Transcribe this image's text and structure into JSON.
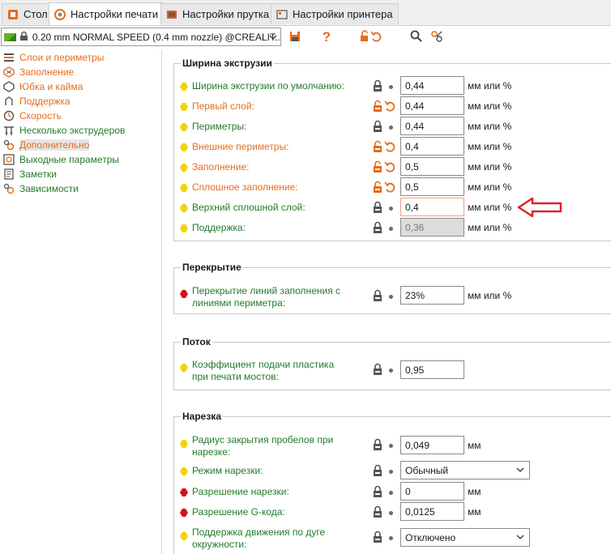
{
  "tabs": [
    {
      "label": "Стол",
      "icon": "plate-icon"
    },
    {
      "label": "Настройки печати",
      "icon": "print-settings-icon"
    },
    {
      "label": "Настройки прутка",
      "icon": "filament-icon"
    },
    {
      "label": "Настройки принтера",
      "icon": "printer-icon"
    }
  ],
  "preset": {
    "value": "0.20 mm NORMAL SPEED (0.4 mm nozzle) @CREALIT..."
  },
  "toolbar": {
    "help_label": "?"
  },
  "sidebar": {
    "items": [
      {
        "label": "Слои и периметры",
        "color": "orange"
      },
      {
        "label": "Заполнение",
        "color": "orange"
      },
      {
        "label": "Юбка и кайма",
        "color": "orange"
      },
      {
        "label": "Поддержка",
        "color": "orange"
      },
      {
        "label": "Скорость",
        "color": "orange"
      },
      {
        "label": "Несколько экструдеров",
        "color": "green"
      },
      {
        "label": "Дополнительно",
        "color": "orange"
      },
      {
        "label": "Выходные параметры",
        "color": "green"
      },
      {
        "label": "Заметки",
        "color": "green"
      },
      {
        "label": "Зависимости",
        "color": "green"
      }
    ]
  },
  "groups": {
    "extrusion_width": {
      "title": "Ширина экструзии",
      "rows": [
        {
          "label": "Ширина экструзии по умолчанию:",
          "value": "0,44",
          "unit": "мм или %"
        },
        {
          "label": "Первый слой:",
          "value": "0,44",
          "unit": "мм или %"
        },
        {
          "label": "Периметры:",
          "value": "0,44",
          "unit": "мм или %"
        },
        {
          "label": "Внешние периметры:",
          "value": "0,4",
          "unit": "мм или %"
        },
        {
          "label": "Заполнение:",
          "value": "0,5",
          "unit": "мм или %"
        },
        {
          "label": "Сплошное заполнение:",
          "value": "0,5",
          "unit": "мм или %"
        },
        {
          "label": "Верхний сплошной слой:",
          "value": "0,4",
          "unit": "мм или %"
        },
        {
          "label": "Поддержка:",
          "value": "0,36",
          "unit": "мм или %"
        }
      ]
    },
    "overlap": {
      "title": "Перекрытие",
      "rows": [
        {
          "label_line1": "Перекрытие линий заполнения с",
          "label_line2": "линиями периметра:",
          "value": "23%",
          "unit": "мм или %"
        }
      ]
    },
    "flow": {
      "title": "Поток",
      "rows": [
        {
          "label_line1": "Коэффициент подачи пластика",
          "label_line2": "при печати мостов:",
          "value": "0,95"
        }
      ]
    },
    "slicing": {
      "title": "Нарезка",
      "rows": [
        {
          "label_line1": "Радиус закрытия пробелов при",
          "label_line2": "нарезке:",
          "value": "0,049",
          "unit": "мм"
        },
        {
          "label": "Режим нарезки:",
          "value": "Обычный"
        },
        {
          "label": "Разрешение нарезки:",
          "value": "0",
          "unit": "мм"
        },
        {
          "label": "Разрешение G-кода:",
          "value": "0,0125",
          "unit": "мм"
        },
        {
          "label_line1": "Поддержка движения по дуге",
          "label_line2": "окружности:",
          "value": "Отключено"
        }
      ]
    }
  },
  "colors": {
    "orange": "#e56c1f",
    "green": "#247a2b",
    "bullet_yellow": "#f2d20a",
    "bullet_red": "#d4101a",
    "annotation_red": "#e0202a"
  }
}
